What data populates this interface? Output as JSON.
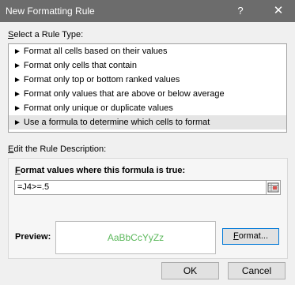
{
  "window": {
    "title": "New Formatting Rule",
    "help": "?",
    "close": "✕"
  },
  "rule_type": {
    "label_prefix": "S",
    "label_rest": "elect a Rule Type:",
    "items": [
      {
        "label": "Format all cells based on their values",
        "selected": false
      },
      {
        "label": "Format only cells that contain",
        "selected": false
      },
      {
        "label": "Format only top or bottom ranked values",
        "selected": false
      },
      {
        "label": "Format only values that are above or below average",
        "selected": false
      },
      {
        "label": "Format only unique or duplicate values",
        "selected": false
      },
      {
        "label": "Use a formula to determine which cells to format",
        "selected": true
      }
    ]
  },
  "description": {
    "label_prefix": "E",
    "label_rest": "dit the Rule Description:",
    "formula_label_prefix": "F",
    "formula_label_rest": "ormat values where this formula is true:",
    "formula_value": "=J4>=.5",
    "preview_label": "Preview:",
    "preview_text": "AaBbCcYyZz",
    "format_button_prefix": "F",
    "format_button_rest": "ormat..."
  },
  "buttons": {
    "ok": "OK",
    "cancel": "Cancel"
  },
  "colors": {
    "titlebar": "#6c6c6c",
    "preview_text": "#5cb85c",
    "format_button_border": "#0078d7"
  }
}
